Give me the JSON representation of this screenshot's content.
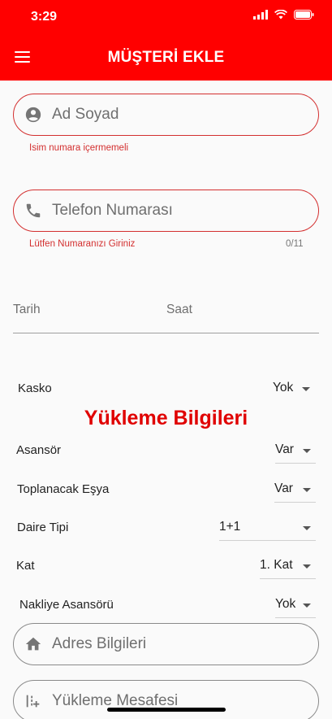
{
  "status_bar": {
    "time": "3:29"
  },
  "header": {
    "title": "MÜŞTERİ EKLE",
    "menu_icon": "hamburger-icon"
  },
  "name_field": {
    "placeholder": "Ad Soyad",
    "helper": "Isim numara içermemeli",
    "icon": "person-icon"
  },
  "phone_field": {
    "placeholder": "Telefon Numarası",
    "helper": "Lütfen Numaranızı Giriniz",
    "counter": "0/11",
    "icon": "phone-icon"
  },
  "datetime": {
    "date_label": "Tarih",
    "time_label": "Saat"
  },
  "kasko": {
    "label": "Kasko",
    "value": "Yok"
  },
  "section_title": "Yükleme Bilgileri",
  "rows": {
    "asansor": {
      "label": "Asansör",
      "value": "Var"
    },
    "esya": {
      "label": "Toplanacak Eşya",
      "value": "Var"
    },
    "daire": {
      "label": "Daire Tipi",
      "value": "1+1"
    },
    "kat": {
      "label": "Kat",
      "value": "1. Kat"
    },
    "nakliye": {
      "label": "Nakliye Asansörü",
      "value": "Yok"
    }
  },
  "address_field": {
    "placeholder": "Adres Bilgileri",
    "icon": "home-icon"
  },
  "distance_field": {
    "placeholder": "Yükleme Mesafesi",
    "icon": "distance-icon"
  },
  "colors": {
    "primary": "#ff0000",
    "error": "#d32f2f",
    "section_title": "#e00000"
  }
}
